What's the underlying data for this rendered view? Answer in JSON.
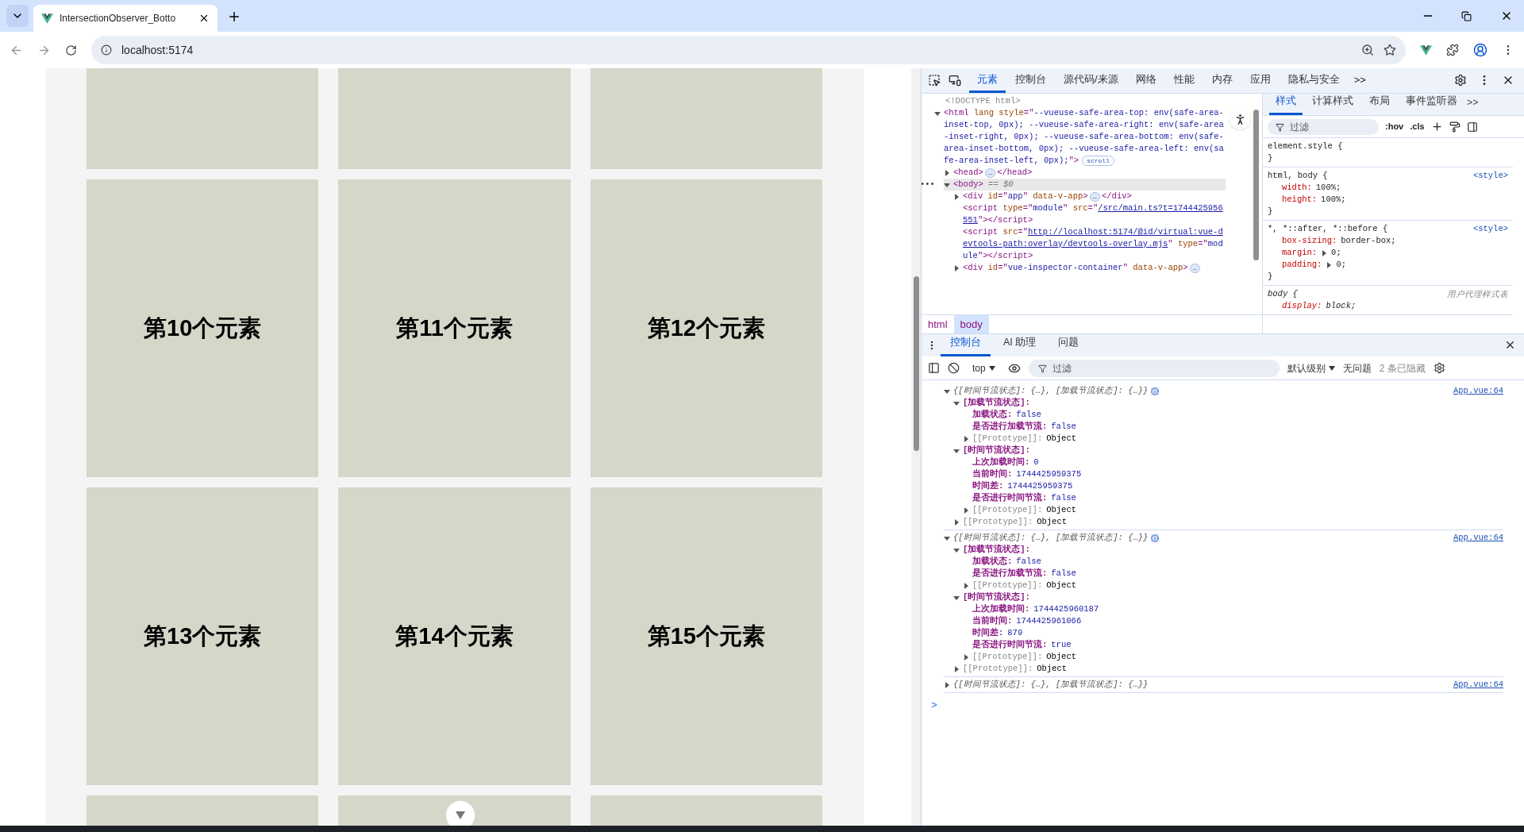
{
  "browser": {
    "tab_title": "IntersectionObserver_Botto",
    "address": "localhost:5174"
  },
  "page": {
    "card_rows": [
      [
        "第10个元素",
        "第11个元素",
        "第12个元素"
      ],
      [
        "第13个元素",
        "第14个元素",
        "第15个元素"
      ]
    ]
  },
  "devtools": {
    "main_tabs": [
      {
        "label": "元素",
        "selected": true
      },
      {
        "label": "控制台",
        "selected": false
      },
      {
        "label": "源代码/来源",
        "selected": false
      },
      {
        "label": "网络",
        "selected": false
      },
      {
        "label": "性能",
        "selected": false
      },
      {
        "label": "内存",
        "selected": false
      },
      {
        "label": "应用",
        "selected": false
      },
      {
        "label": "隐私与安全",
        "selected": false
      }
    ],
    "more": ">>",
    "dom": [
      {
        "kind": "doctype",
        "text": "<!DOCTYPE html>"
      },
      {
        "kind": "element",
        "selected": false,
        "expanded": true,
        "tokens": [
          {
            "kind": "tag",
            "s": "<html"
          },
          {
            "kind": "attr",
            "s": " lang"
          },
          {
            "kind": "attr",
            "s": " style"
          },
          {
            "kind": "tag",
            "s": "=\""
          },
          {
            "kind": "value",
            "s": "--vueuse-safe-area-top: env(safe-area-inset-top, 0px); --vueuse-safe-area-right: env(safe-area-inset-right, 0px); --vueuse-safe-area-bottom: env(safe-area-inset-bottom, 0px); --vueuse-safe-area-left: env(safe-area-inset-left, 0px);"
          },
          {
            "kind": "tag",
            "s": "\">"
          }
        ],
        "badge": "scroll",
        "children": [
          {
            "kind": "element",
            "selected": false,
            "expanded": false,
            "tokens": [
              {
                "kind": "tag",
                "s": "<head>"
              },
              {
                "kind": "more",
                "s": "…"
              },
              {
                "kind": "tag",
                "s": "</head>"
              }
            ]
          },
          {
            "kind": "element",
            "selected": true,
            "gutter": "•••",
            "expanded": true,
            "tokens": [
              {
                "kind": "tag",
                "s": "<body>"
              },
              {
                "kind": "marker",
                "s": " == $0"
              }
            ],
            "children": [
              {
                "kind": "element",
                "selected": false,
                "expanded": false,
                "tokens": [
                  {
                    "kind": "tag",
                    "s": "<div"
                  },
                  {
                    "kind": "attr",
                    "s": " id"
                  },
                  {
                    "kind": "tag",
                    "s": "=\""
                  },
                  {
                    "kind": "value",
                    "s": "app"
                  },
                  {
                    "kind": "tag",
                    "s": "\""
                  },
                  {
                    "kind": "attr",
                    "s": " data-v-app"
                  },
                  {
                    "kind": "tag",
                    "s": ">"
                  },
                  {
                    "kind": "more",
                    "s": "…"
                  },
                  {
                    "kind": "tag",
                    "s": "</div>"
                  }
                ]
              },
              {
                "kind": "leaf",
                "selected": false,
                "tokens": [
                  {
                    "kind": "tag",
                    "s": "<script"
                  },
                  {
                    "kind": "attr",
                    "s": " type"
                  },
                  {
                    "kind": "tag",
                    "s": "=\""
                  },
                  {
                    "kind": "value",
                    "s": "module"
                  },
                  {
                    "kind": "tag",
                    "s": "\""
                  },
                  {
                    "kind": "attr",
                    "s": " src"
                  },
                  {
                    "kind": "tag",
                    "s": "=\""
                  },
                  {
                    "kind": "link",
                    "s": "/src/main.ts?t=1744425956551"
                  },
                  {
                    "kind": "tag",
                    "s": "\"></script>"
                  }
                ]
              },
              {
                "kind": "leaf",
                "selected": false,
                "tokens": [
                  {
                    "kind": "tag",
                    "s": "<script"
                  },
                  {
                    "kind": "attr",
                    "s": " src"
                  },
                  {
                    "kind": "tag",
                    "s": "=\""
                  },
                  {
                    "kind": "link",
                    "s": "http://localhost:5174/@id/virtual:vue-devtools-path:overlay/devtools-overlay.mjs"
                  },
                  {
                    "kind": "tag",
                    "s": "\""
                  },
                  {
                    "kind": "attr",
                    "s": " type"
                  },
                  {
                    "kind": "tag",
                    "s": "=\""
                  },
                  {
                    "kind": "value",
                    "s": "module"
                  },
                  {
                    "kind": "tag",
                    "s": "\"></script>"
                  }
                ]
              },
              {
                "kind": "element",
                "selected": false,
                "expanded": false,
                "tokens": [
                  {
                    "kind": "tag",
                    "s": "<div"
                  },
                  {
                    "kind": "attr",
                    "s": " id"
                  },
                  {
                    "kind": "tag",
                    "s": "=\""
                  },
                  {
                    "kind": "value",
                    "s": "vue-inspector-container"
                  },
                  {
                    "kind": "tag",
                    "s": "\""
                  },
                  {
                    "kind": "attr",
                    "s": " data-v-app"
                  },
                  {
                    "kind": "tag",
                    "s": ">"
                  },
                  {
                    "kind": "more",
                    "s": "…"
                  }
                ]
              }
            ]
          }
        ]
      }
    ],
    "breadcrumbs": [
      {
        "label": "html",
        "selected": false
      },
      {
        "label": "body",
        "selected": true
      }
    ],
    "styles_tabs": [
      {
        "label": "样式",
        "selected": true
      },
      {
        "label": "计算样式",
        "selected": false
      },
      {
        "label": "布局",
        "selected": false
      },
      {
        "label": "事件监听器",
        "selected": false
      }
    ],
    "styles_more": ">>",
    "styles_filter": {
      "placeholder": "过滤"
    },
    "styles_buttons": [
      ":hov",
      ".cls"
    ],
    "rules": [
      {
        "selector": "element.style {",
        "close": "}",
        "user_agent": false
      },
      {
        "selector": "html, body {",
        "source": "<style>",
        "declarations": [
          {
            "kind": "plain",
            "prop": "width:",
            "value": "100%;"
          },
          {
            "kind": "plain",
            "prop": "height:",
            "value": "100%;"
          }
        ],
        "close": "}",
        "user_agent": false
      },
      {
        "selector": "*, *::after, *::before {",
        "source": "<style>",
        "declarations": [
          {
            "kind": "plain",
            "prop": "box-sizing:",
            "value": "border-box;"
          },
          {
            "kind": "expandable",
            "prop": "margin:",
            "value": "0;"
          },
          {
            "kind": "expandable",
            "prop": "padding:",
            "value": "0;"
          }
        ],
        "close": "}",
        "user_agent": false
      },
      {
        "selector": "body {",
        "source": "用户代理样式表",
        "declarations": [
          {
            "kind": "plain",
            "prop": "display:",
            "value": "block;"
          }
        ],
        "user_agent": true
      }
    ],
    "drawer_tabs": [
      {
        "label": "控制台",
        "selected": true
      },
      {
        "label": "AI 助理",
        "selected": false
      },
      {
        "label": "问题",
        "selected": false
      }
    ],
    "console_toolbar": {
      "context": "top",
      "filter_placeholder": "过滤",
      "level": "默认级别",
      "issues": "无问题",
      "hidden": "2 条已隐藏"
    },
    "logs": [
      {
        "summary": "{[时间节流状态]: {…}, [加载节流状态]: {…}}",
        "source": "App.vue:64",
        "expanded": true,
        "children": [
          {
            "kind": "group",
            "key": "[加载节流状态]:",
            "expanded": true,
            "children": [
              {
                "kind": "value",
                "key": "加载状态:",
                "value": "false"
              },
              {
                "kind": "value",
                "key": "是否进行加载节流:",
                "value": "false"
              },
              {
                "kind": "proto",
                "key": "[[Prototype]]:",
                "value": "Object"
              }
            ]
          },
          {
            "kind": "group",
            "key": "[时间节流状态]:",
            "expanded": true,
            "children": [
              {
                "kind": "value",
                "key": "上次加载时间:",
                "value": "0"
              },
              {
                "kind": "value",
                "key": "当前时间:",
                "value": "1744425959375"
              },
              {
                "kind": "value",
                "key": "时间差:",
                "value": "1744425959375"
              },
              {
                "kind": "value",
                "key": "是否进行时间节流:",
                "value": "false"
              },
              {
                "kind": "proto",
                "key": "[[Prototype]]:",
                "value": "Object"
              }
            ]
          },
          {
            "kind": "proto",
            "key": "[[Prototype]]:",
            "value": "Object"
          }
        ]
      },
      {
        "summary": "{[时间节流状态]: {…}, [加载节流状态]: {…}}",
        "source": "App.vue:64",
        "expanded": true,
        "children": [
          {
            "kind": "group",
            "key": "[加载节流状态]:",
            "expanded": true,
            "children": [
              {
                "kind": "value",
                "key": "加载状态:",
                "value": "false"
              },
              {
                "kind": "value",
                "key": "是否进行加载节流:",
                "value": "false"
              },
              {
                "kind": "proto",
                "key": "[[Prototype]]:",
                "value": "Object"
              }
            ]
          },
          {
            "kind": "group",
            "key": "[时间节流状态]:",
            "expanded": true,
            "children": [
              {
                "kind": "value",
                "key": "上次加载时间:",
                "value": "1744425960187"
              },
              {
                "kind": "value",
                "key": "当前时间:",
                "value": "1744425961066"
              },
              {
                "kind": "value",
                "key": "时间差:",
                "value": "879"
              },
              {
                "kind": "value",
                "key": "是否进行时间节流:",
                "value": "true"
              },
              {
                "kind": "proto",
                "key": "[[Prototype]]:",
                "value": "Object"
              }
            ]
          },
          {
            "kind": "proto",
            "key": "[[Prototype]]:",
            "value": "Object"
          }
        ]
      },
      {
        "summary": "{[时间节流状态]: {…}, [加载节流状态]: {…}}",
        "source": "App.vue:64",
        "expanded": false
      }
    ],
    "prompt": ">"
  }
}
